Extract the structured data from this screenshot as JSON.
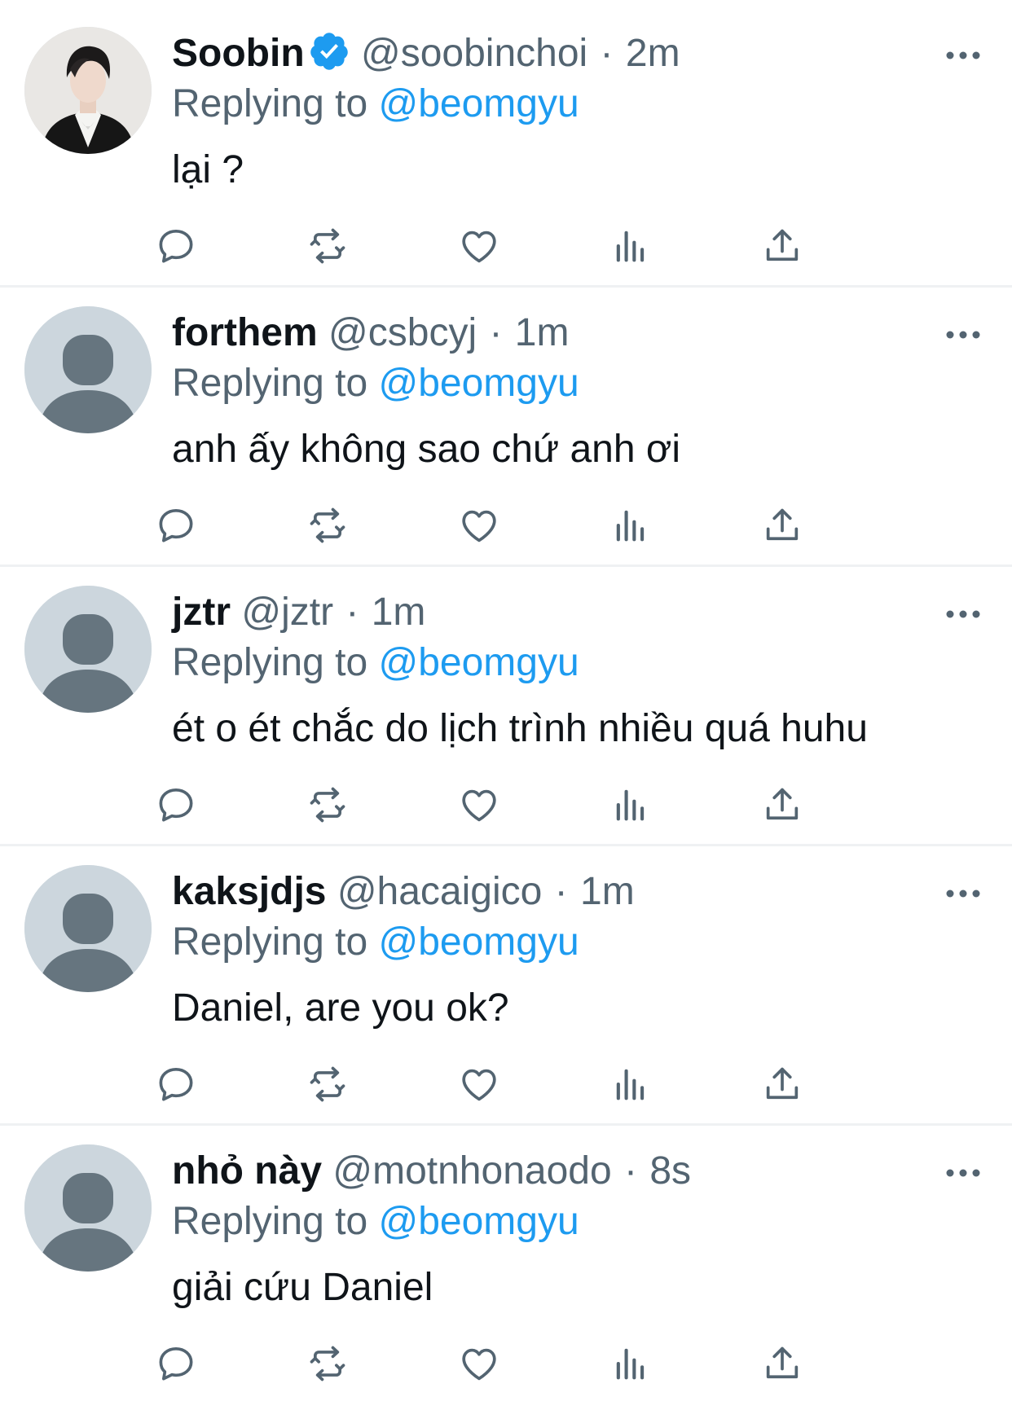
{
  "colors": {
    "link": "#1d9bf0",
    "secondary_text": "#536471",
    "text": "#0f1419",
    "separator": "#eff1f3",
    "verified": "#1d9bf0"
  },
  "reply_prefix": "Replying to",
  "tweets": [
    {
      "display_name": "Soobin",
      "verified": true,
      "handle": "@soobinchoi",
      "time": "2m",
      "reply_to": "@beomgyu",
      "text": "lại ?",
      "avatar": "photo-avatar"
    },
    {
      "display_name": "forthem",
      "verified": false,
      "handle": "@csbcyj",
      "time": "1m",
      "reply_to": "@beomgyu",
      "text": "anh ấy không sao chứ anh ơi",
      "avatar": "default-avatar"
    },
    {
      "display_name": "jztr",
      "verified": false,
      "handle": "@jztr",
      "time": "1m",
      "reply_to": "@beomgyu",
      "text": "ét o ét chắc do lịch trình nhiều quá huhu",
      "avatar": "default-avatar"
    },
    {
      "display_name": "kaksjdjs",
      "verified": false,
      "handle": "@hacaigico",
      "time": "1m",
      "reply_to": "@beomgyu",
      "text": "Daniel, are you ok?",
      "avatar": "default-avatar"
    },
    {
      "display_name": "nhỏ này",
      "verified": false,
      "handle": "@motnhonaodo",
      "time": "8s",
      "reply_to": "@beomgyu",
      "text": "giải cứu Daniel",
      "avatar": "default-avatar"
    }
  ],
  "actions": [
    "reply-icon",
    "retweet-icon",
    "like-icon",
    "analytics-icon",
    "share-icon"
  ]
}
